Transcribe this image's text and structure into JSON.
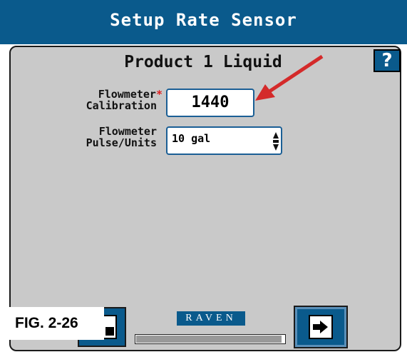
{
  "header": {
    "title": "Setup Rate Sensor"
  },
  "panel": {
    "product_title": "Product 1 Liquid",
    "help_label": "?"
  },
  "flowmeter_calibration": {
    "label_line1": "Flowmeter",
    "required_marker": "*",
    "label_line2": "Calibration",
    "value": "1440"
  },
  "flowmeter_pulse_units": {
    "label_line1": "Flowmeter",
    "label_line2": "Pulse/Units",
    "value": "10 gal"
  },
  "footer": {
    "figure_label": "FIG. 2-26",
    "logo_text": "RAVEN",
    "progress_fraction": 0.98
  },
  "colors": {
    "title_bar": "#0a5a8c",
    "panel_bg": "#c9c9c9",
    "field_border": "#1b5f95",
    "annotation_arrow": "#d42a2a",
    "required_asterisk": "#e02020"
  },
  "icons": {
    "help": "help-icon",
    "bottom_left": "document-icon",
    "next": "next-page-icon",
    "spinner": "spinner-arrows-icon"
  }
}
